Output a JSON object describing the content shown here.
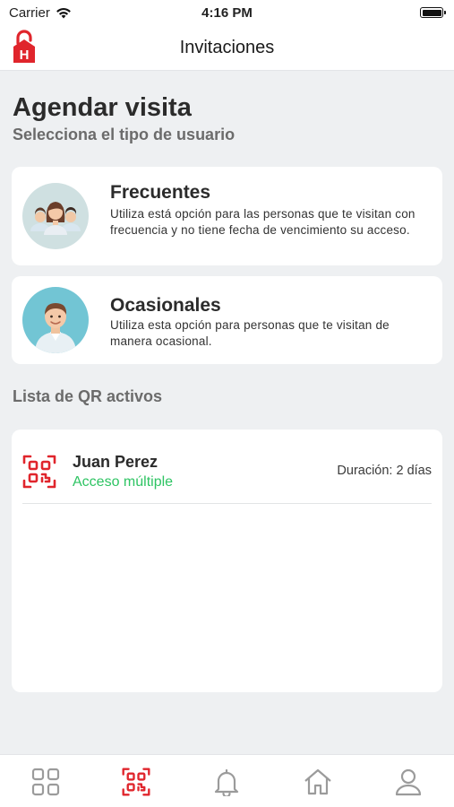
{
  "status_bar": {
    "carrier": "Carrier",
    "time": "4:16 PM",
    "icons": [
      "wifi-icon",
      "battery-icon"
    ]
  },
  "nav": {
    "title": "Invitaciones",
    "logo_icon": "house-lock-logo",
    "logo_letter": "H"
  },
  "page": {
    "heading": "Agendar visita",
    "subheading": "Selecciona el tipo de usuario"
  },
  "user_types": [
    {
      "title": "Frecuentes",
      "description": "Utiliza está opción para las personas que te visitan con frecuencia y no tiene fecha de vencimiento su acceso.",
      "icon": "group-avatar-icon"
    },
    {
      "title": "Ocasionales",
      "description": "Utiliza esta opción para personas que te visitan de manera ocasional.",
      "icon": "single-avatar-icon"
    }
  ],
  "active_qr": {
    "section_label": "Lista de QR activos",
    "items": [
      {
        "name": "Juan Perez",
        "access": "Acceso múltiple",
        "duration": "Duración: 2 días",
        "icon": "qr-code-icon"
      }
    ]
  },
  "tab_bar": {
    "items": [
      {
        "name": "dashboard",
        "icon": "grid-icon",
        "active": false
      },
      {
        "name": "qr",
        "icon": "qr-code-icon",
        "active": true
      },
      {
        "name": "notifications",
        "icon": "bell-icon",
        "active": false
      },
      {
        "name": "home",
        "icon": "home-icon",
        "active": false
      },
      {
        "name": "profile",
        "icon": "user-icon",
        "active": false
      }
    ]
  },
  "colors": {
    "accent_red": "#e0252c",
    "success_green": "#2ec463",
    "background": "#eef0f2",
    "inactive_icon": "#9b9b9b"
  }
}
